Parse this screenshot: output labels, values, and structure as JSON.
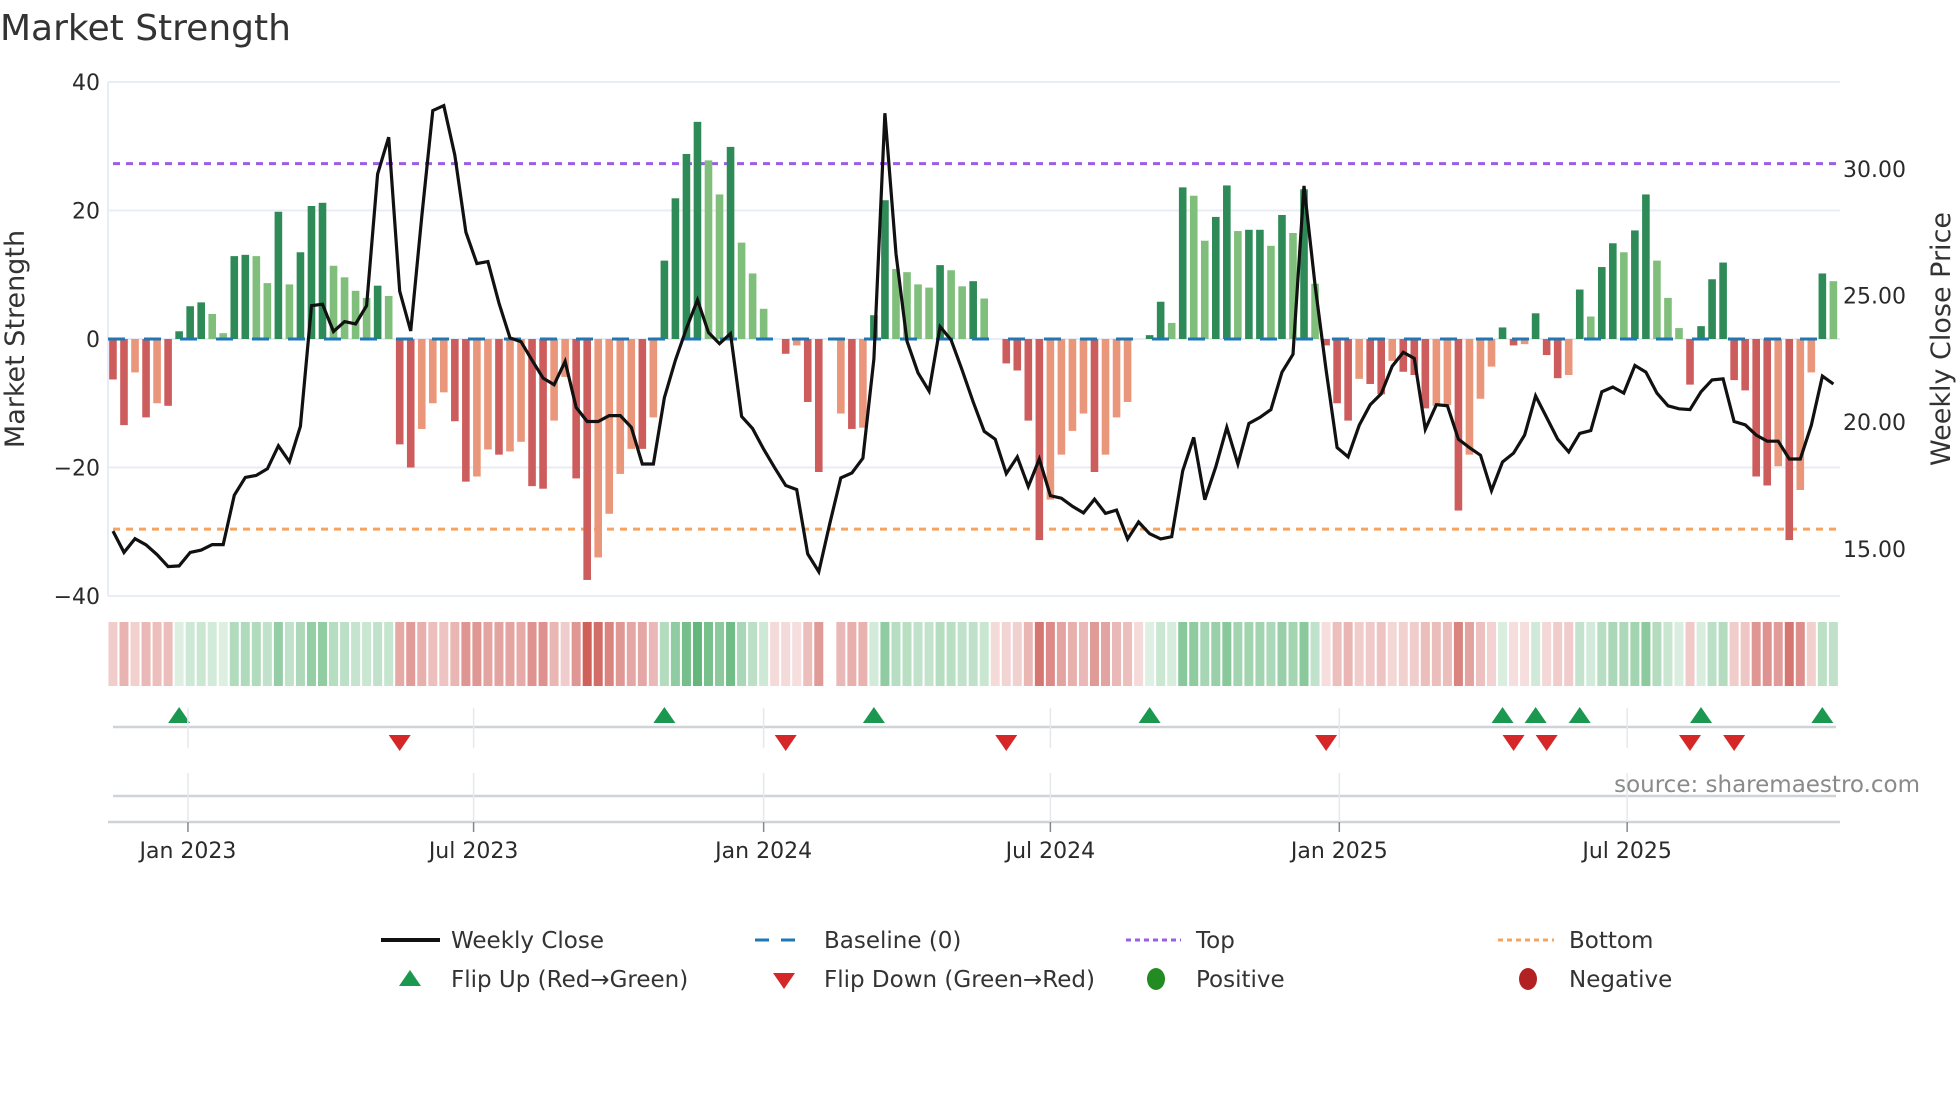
{
  "title": "Market Strength",
  "source": "source: sharemaestro.com",
  "colors": {
    "bar_up_strong": "#2e8b57",
    "bar_up_weak": "#7fbf7b",
    "bar_down_strong": "#cd5c5c",
    "bar_down_weak": "#e9967a",
    "baseline": "#1f77b4",
    "top": "#9b5de5",
    "bottom": "#f4a460",
    "close": "#111111",
    "flip_up": "#1a9850",
    "flip_down": "#d62728",
    "positive": "#228b22",
    "negative": "#b22222",
    "grid": "#e8ecf4",
    "panel_line": "#cfd2d6"
  },
  "legend": {
    "weekly_close": "Weekly Close",
    "baseline": "Baseline (0)",
    "top": "Top",
    "bottom": "Bottom",
    "flip_up": "Flip Up (Red→Green)",
    "flip_down": "Flip Down (Green→Red)",
    "positive": "Positive",
    "negative": "Negative"
  },
  "chart_data": {
    "type": "bar",
    "title": "Market Strength",
    "ylabel": "Market Strength",
    "ylabel_right": "Weekly Close Price",
    "xlabel": "",
    "ylim": [
      -40,
      40
    ],
    "ylim_right": [
      13.14,
      33.43
    ],
    "x_range_weeks": [
      -0.45,
      156.6
    ],
    "yticks": [
      40,
      20,
      0,
      -20,
      -40
    ],
    "yticks_labels": [
      "40",
      "20",
      "0",
      "−20",
      "−40"
    ],
    "yticks_right": [
      30,
      25,
      20,
      15
    ],
    "yticks_right_labels": [
      "30.00",
      "25.00",
      "20.00",
      "15.00"
    ],
    "xticks": [
      {
        "label": "Jan 2023",
        "week": 6.8
      },
      {
        "label": "Jul 2023",
        "week": 32.7
      },
      {
        "label": "Jan 2024",
        "week": 59.0
      },
      {
        "label": "Jul 2024",
        "week": 85.0
      },
      {
        "label": "Jan 2025",
        "week": 111.2
      },
      {
        "label": "Jul 2025",
        "week": 137.3
      }
    ],
    "top_level": 27.3,
    "bottom_level": -29.6,
    "baseline_level": 0,
    "strength": [
      -6.3,
      -13.4,
      -5.2,
      -12.2,
      -10,
      -10.4,
      1.2,
      5.1,
      5.7,
      3.9,
      0.9,
      12.9,
      13.1,
      12.9,
      8.7,
      19.8,
      8.5,
      13.5,
      20.7,
      21.2,
      11.4,
      9.6,
      7.5,
      6.4,
      8.3,
      6.7,
      -16.4,
      -20,
      -14,
      -10,
      -8.3,
      -12.8,
      -22.2,
      -21.4,
      -17.2,
      -18,
      -17.5,
      -16,
      -22.9,
      -23.3,
      -12.7,
      -5.9,
      -21.7,
      -37.5,
      -34,
      -27.2,
      -21,
      -17.1,
      -17.1,
      -12.2,
      12.2,
      21.9,
      28.8,
      33.8,
      27.8,
      22.5,
      29.9,
      15,
      10.2,
      4.7,
      0,
      -2.3,
      -1,
      -9.8,
      -20.7,
      null,
      -11.6,
      -14,
      -13.8,
      3.7,
      21.6,
      10.9,
      10.4,
      8.5,
      8,
      11.5,
      10.7,
      8.2,
      9,
      6.3,
      0,
      -3.8,
      -4.9,
      -12.7,
      -31.3,
      -25,
      -18,
      -14.3,
      -11.6,
      -20.7,
      -18,
      -12.2,
      -9.8,
      0,
      0.6,
      5.8,
      2.5,
      23.6,
      22.3,
      15.3,
      19,
      23.9,
      16.8,
      17,
      17,
      14.5,
      19.3,
      16.5,
      23.3,
      8.6,
      -1,
      -10,
      -12.7,
      -6.2,
      -7,
      -8.6,
      -3.4,
      -5.1,
      -5.6,
      -10.8,
      -10.4,
      -10.3,
      -26.7,
      -18,
      -9.3,
      -4.3,
      1.8,
      -1,
      -0.8,
      4,
      -2.5,
      -6.1,
      -5.6,
      7.7,
      3.5,
      11.2,
      14.9,
      13.5,
      16.9,
      22.5,
      12.2,
      6.4,
      1.7,
      -7.1,
      2,
      9.3,
      11.9,
      -6.4,
      -8,
      -21.4,
      -22.8,
      -19.8,
      -31.3,
      -23.5,
      -5.2,
      10.2,
      9
    ],
    "weekly_close": [
      15.7,
      14.86,
      15.4,
      15.16,
      14.77,
      14.3,
      14.33,
      14.86,
      14.95,
      15.17,
      15.17,
      17.12,
      17.82,
      17.9,
      18.16,
      19.07,
      18.44,
      19.84,
      24.6,
      24.66,
      23.58,
      23.97,
      23.88,
      24.6,
      29.8,
      31.25,
      25.17,
      23.6,
      28.13,
      32.3,
      32.5,
      30.55,
      27.5,
      26.26,
      26.34,
      24.7,
      23.33,
      23.18,
      22.45,
      21.74,
      21.48,
      22.4,
      20.58,
      20.03,
      20.03,
      20.26,
      20.26,
      19.8,
      18.35,
      18.35,
      20.97,
      22.45,
      23.7,
      24.83,
      23.54,
      23.1,
      23.5,
      20.23,
      19.75,
      18.94,
      18.2,
      17.5,
      17.34,
      14.8,
      14.1,
      16,
      17.8,
      18,
      18.58,
      22.5,
      32.2,
      26.65,
      23.2,
      21.95,
      21.23,
      23.77,
      23.25,
      22.06,
      20.8,
      19.64,
      19.33,
      17.97,
      18.63,
      17.46,
      18.55,
      17.1,
      17,
      16.68,
      16.42,
      16.96,
      16.4,
      16.53,
      15.39,
      16.06,
      15.6,
      15.39,
      15.48,
      18.08,
      19.4,
      16.94,
      18.24,
      19.8,
      18.35,
      19.95,
      20.19,
      20.5,
      21.98,
      22.68,
      29.33,
      25.4,
      22.06,
      19,
      18.63,
      19.88,
      20.69,
      21.12,
      22.21,
      22.76,
      22.52,
      19.72,
      20.69,
      20.65,
      19.33,
      19,
      18.7,
      17.3,
      18.43,
      18.78,
      19.49,
      21.04,
      20.19,
      19.33,
      18.83,
      19.56,
      19.67,
      21.2,
      21.39,
      21.15,
      22.24,
      21.98,
      21.15,
      20.65,
      20.53,
      20.5,
      21.2,
      21.67,
      21.71,
      20.03,
      19.9,
      19.49,
      19.25,
      19.25,
      18.55,
      18.55,
      19.88,
      21.82,
      21.51
    ]
  }
}
